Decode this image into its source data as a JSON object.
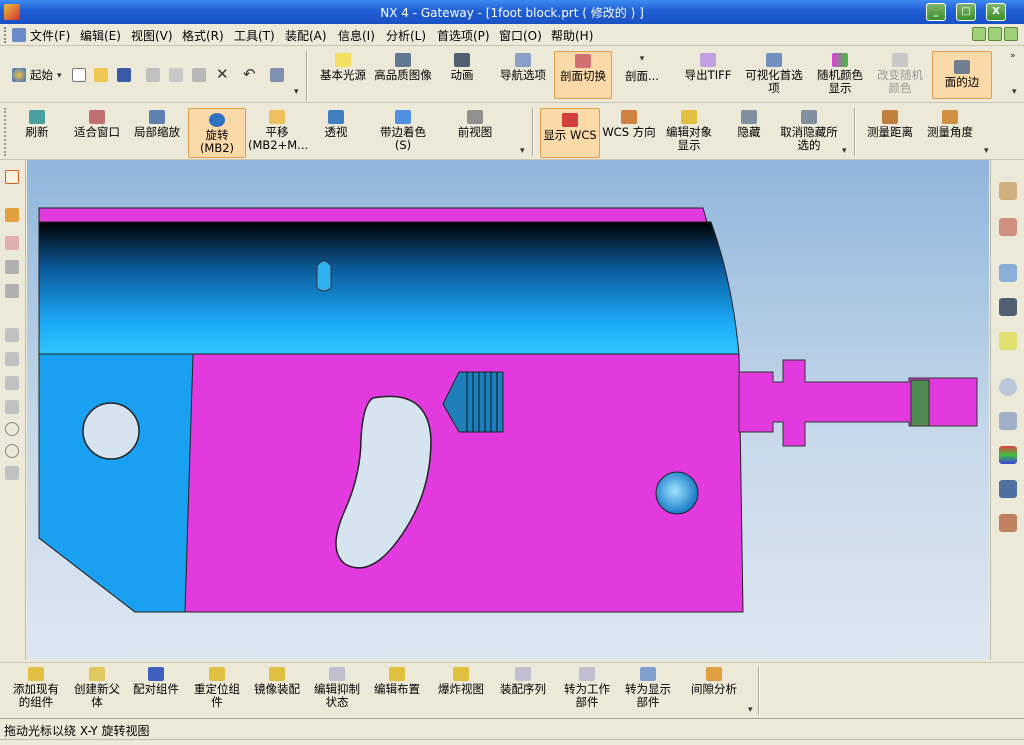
{
  "window": {
    "title": "NX 4 - Gateway - [1foot block.prt ( 修改的 ) ]",
    "minimize": "_",
    "maximize": "□",
    "close": "X"
  },
  "menubar": {
    "items": [
      "文件(F)",
      "编辑(E)",
      "视图(V)",
      "格式(R)",
      "工具(T)",
      "装配(A)",
      "信息(I)",
      "分析(L)",
      "首选项(P)",
      "窗口(O)",
      "帮助(H)"
    ]
  },
  "standard_toolbar": {
    "start_label": "起始"
  },
  "visualization_toolbar": {
    "items": [
      "基本光源",
      "高品质图像",
      "动画",
      "导航选项",
      "剖面切换",
      "剖面...",
      "导出TIFF",
      "可视化首选项",
      "随机颜色显示",
      "改变随机颜色",
      "面的边"
    ]
  },
  "view_toolbar": {
    "items": [
      "刷新",
      "适合窗口",
      "局部缩放",
      "旋转(MB2)",
      "平移(MB2+M...",
      "透视",
      "带边着色(S)",
      "前视图"
    ]
  },
  "utility_toolbar": {
    "items": [
      "显示 WCS",
      "WCS 方向",
      "编辑对象显示",
      "隐藏",
      "取消隐藏所选的",
      "测量距离",
      "测量角度"
    ]
  },
  "assembly_toolbar": {
    "items": [
      "添加现有的组件",
      "创建新父体",
      "配对组件",
      "重定位组件",
      "镜像装配",
      "编辑抑制状态",
      "编辑布置",
      "爆炸视图",
      "装配序列",
      "转为工作部件",
      "转为显示部件",
      "间隙分析"
    ]
  },
  "status": {
    "message": "拖动光标以绕 X-Y 旋转视图"
  },
  "colors": {
    "part_magenta": "#e33ae0",
    "part_blue": "#1aa0f0",
    "active_tool": "#fbd9a8",
    "title_blue": "#1f5fd6"
  }
}
